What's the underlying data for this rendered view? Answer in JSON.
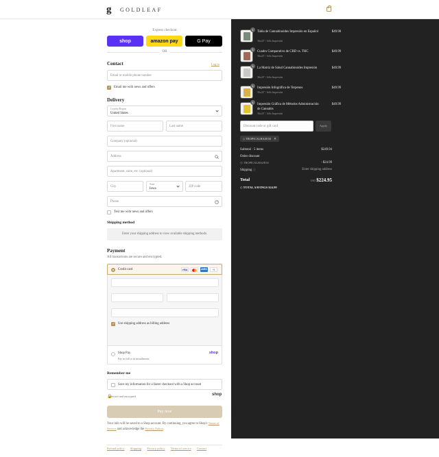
{
  "header": {
    "logo_mark": "g",
    "brand": "GOLDLEAF",
    "bag_icon": "shopping-bag-icon"
  },
  "express": {
    "title": "Express checkout",
    "shop_pay": "shop",
    "amazon_pay": "amazon pay",
    "google_pay": "G Pay",
    "or": "OR"
  },
  "contact": {
    "title": "Contact",
    "login_link": "Log in",
    "email_placeholder": "Email or mobile phone number",
    "news_label": "Email me with news and offers",
    "news_checked": true
  },
  "delivery": {
    "title": "Delivery",
    "country_label": "Country/Region",
    "country_value": "United States",
    "first_name": "First name",
    "last_name": "Last name",
    "company": "Company (optional)",
    "address": "Address",
    "apartment": "Apartment, suite, etc. (optional)",
    "city": "City",
    "state_label": "State",
    "state_value": "Iowa",
    "zip": "ZIP code",
    "phone": "Phone",
    "text_label": "Text me with news and offers"
  },
  "shipping_method": {
    "title": "Shipping method",
    "message": "Enter your shipping address to view available shipping methods."
  },
  "payment": {
    "title": "Payment",
    "subtitle": "All transactions are secure and encrypted.",
    "credit_card": "Credit card",
    "cards": [
      "VISA",
      "MC",
      "AMEX",
      "+5"
    ],
    "billing_label": "Use shipping address as billing address",
    "billing_checked": true,
    "shoppay_label": "Shop Pay",
    "shoppay_sub": "Pay in full or in installments",
    "shoppay_logo": "shop"
  },
  "remember": {
    "title": "Remember me",
    "save_label": "Save my information for a faster checkout with a Shop account",
    "secure": "Secure and encrypted",
    "shop_logo": "shop"
  },
  "pay_now": "Pay now",
  "footer_note": {
    "text": "Your info will be saved to a Shop account. By continuing, you agree to Shop's",
    "tos": "Terms of Service",
    "and": "and acknowledge the",
    "privacy": "Privacy Policy",
    "dot": "."
  },
  "footer_links": [
    "Refund policy",
    "Shipping",
    "Privacy policy",
    "Terms of service",
    "Contact"
  ],
  "cart": {
    "items": [
      {
        "name": "Tabla de Cannabinoides Impresión en Español",
        "variant": "36x24\" / Sólo Impresión",
        "price": "$49.98",
        "qty": "1",
        "thumb_color": "#7a8a7a"
      },
      {
        "name": "Cuadro Comparativo de CBD vs. THC",
        "variant": "36x24\" / Sólo Impresión",
        "price": "$49.99",
        "qty": "1",
        "thumb_color": "#a06a5a"
      },
      {
        "name": "La Matriz de Salud Cannabinoides Impresión",
        "variant": "36x24\" / Sólo Impresión",
        "price": "$49.99",
        "qty": "1",
        "thumb_color": "#c8c8c8"
      },
      {
        "name": "Impresión Infográfica de Terpenos",
        "variant": "36x24\" / Sólo Impresión",
        "price": "$49.99",
        "qty": "1",
        "thumb_color": "#d9b24a"
      },
      {
        "name": "Impresión Gráfica de Métodos Administración de Cannabis",
        "variant": "36x24\" / Sólo Impresión",
        "price": "$49.99",
        "qty": "1",
        "thumb_color": "#e2c23a"
      }
    ],
    "discount_placeholder": "Discount code or gift card",
    "apply": "Apply",
    "applied_code": "TROPICALHAZE50",
    "subtotal_label": "Subtotal · 5 items",
    "subtotal_value": "$249.94",
    "order_discount_label": "Order discount",
    "discount_code": "TROPICALHAZE50",
    "discount_value": "- $24.99",
    "shipping_label": "Shipping",
    "shipping_value": "Enter shipping address",
    "total_label": "Total",
    "currency": "USD",
    "total_value": "$224.95",
    "savings_label": "TOTAL SAVINGS",
    "savings_value": "$24.99"
  },
  "colors": {
    "accent": "#b5975f",
    "dark_panel": "#222222",
    "shop_purple": "#5a31f4",
    "amazon_yellow": "#ffd814"
  }
}
